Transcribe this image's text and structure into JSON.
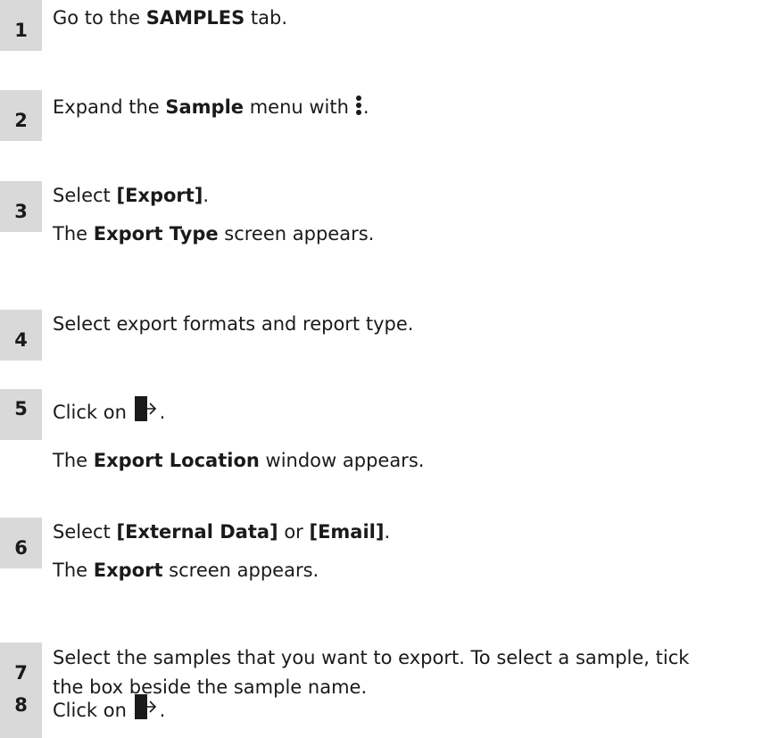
{
  "steps": [
    {
      "num": "1",
      "pre": "Go to the ",
      "bold": "SAMPLES",
      "post": " tab."
    },
    {
      "num": "2",
      "pre": "Expand the ",
      "bold": "Sample",
      "post": " menu with",
      "icon": "kebab-menu-icon",
      "trail": "."
    },
    {
      "num": "3",
      "pre": "Select ",
      "bold": "[Export]",
      "post": ".",
      "result": {
        "pre": "The ",
        "bold": "Export Type",
        "post": " screen appears."
      }
    },
    {
      "num": "4",
      "text": "Select export formats and report type."
    },
    {
      "num": "5",
      "pre": "Click on ",
      "icon": "next-arrow-icon",
      "trail": ".",
      "result": {
        "pre": "The ",
        "bold": "Export Location",
        "post": " window appears."
      }
    },
    {
      "num": "6",
      "pre": "Select ",
      "bold": "[External Data]",
      "mid": " or ",
      "bold2": "[Email]",
      "post": ".",
      "result": {
        "pre": "The ",
        "bold": "Export",
        "post": " screen appears."
      }
    },
    {
      "num": "7",
      "line1": "Select the samples that you want to export. To select a sample, tick",
      "line2": "the box beside the sample name."
    },
    {
      "num": "8",
      "pre": "Click on ",
      "icon": "next-arrow-icon",
      "trail": "."
    }
  ]
}
